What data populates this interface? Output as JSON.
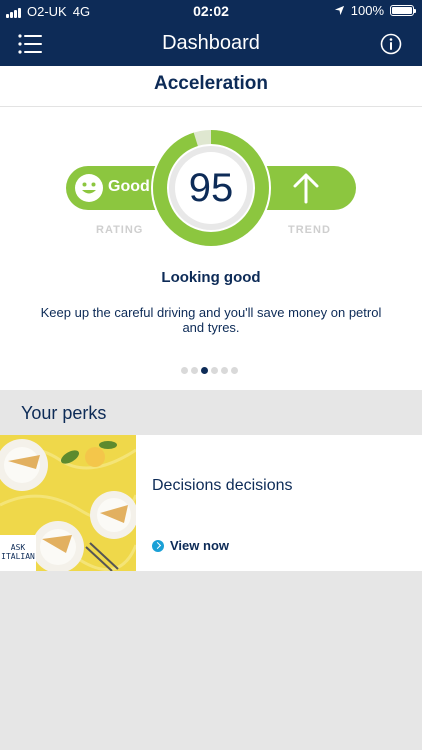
{
  "status_bar": {
    "carrier": "O2-UK",
    "network": "4G",
    "time": "02:02",
    "battery": "100%",
    "battery_level": 1.0
  },
  "nav": {
    "title": "Dashboard",
    "menu_icon": "menu-icon",
    "info_icon": "info-icon"
  },
  "card": {
    "title": "Acceleration",
    "rating_label": "RATING",
    "rating_value": "Good",
    "trend_label": "TREND",
    "score": "95",
    "score_value": 95,
    "headline": "Looking good",
    "description": "Keep up the careful driving and you'll save money on petrol and tyres.",
    "carousel": {
      "count": 6,
      "active_index": 2
    }
  },
  "perks": {
    "title": "Your perks",
    "items": [
      {
        "name": "Decisions decisions",
        "cta": "View now",
        "brand": "ASK ITALIAN"
      }
    ]
  },
  "colors": {
    "navy": "#0d2b57",
    "green": "#8cc63f",
    "accent_blue": "#1aa0d6",
    "background": "#e6e6e6"
  }
}
